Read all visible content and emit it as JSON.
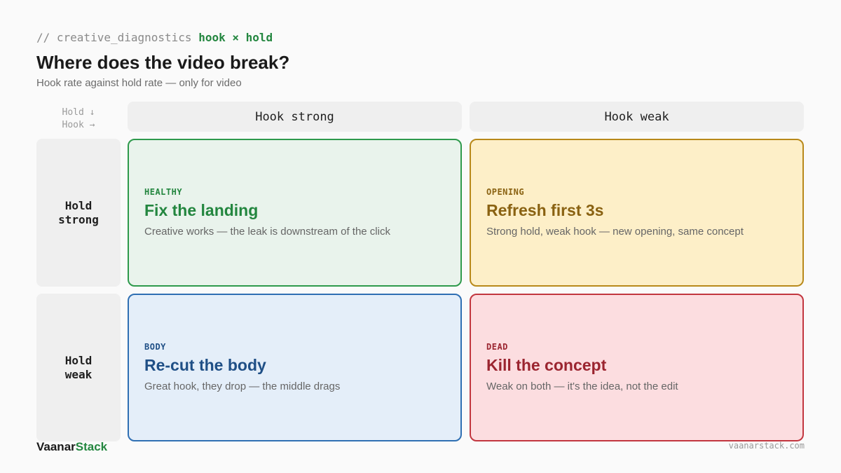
{
  "header": {
    "eyebrow_prefix": "// creative_diagnostics",
    "eyebrow_highlight": "hook × hold",
    "title": "Where does the video break?",
    "subtitle": "Hook rate against hold rate — only for video"
  },
  "axis_legend": {
    "rows_label": "Hold ↓",
    "cols_label": "Hook →"
  },
  "columns": [
    {
      "label": "Hook strong"
    },
    {
      "label": "Hook weak"
    }
  ],
  "rows": [
    {
      "line1": "Hold",
      "line2": "strong"
    },
    {
      "line1": "Hold",
      "line2": "weak"
    }
  ],
  "quadrants": [
    {
      "tag": "HEALTHY",
      "heading": "Fix the landing",
      "description": "Creative works — the leak is downstream of the click",
      "accent": "#23863f",
      "background": "#e9f3ec",
      "border": "#2e9a4c"
    },
    {
      "tag": "OPENING",
      "heading": "Refresh first 3s",
      "description": "Strong hold, weak hook — new opening, same concept",
      "accent": "#8a6212",
      "background": "#fdefc8",
      "border": "#b8891a"
    },
    {
      "tag": "BODY",
      "heading": "Re-cut the body",
      "description": "Great hook, they drop — the middle drags",
      "accent": "#1f4f86",
      "background": "#e4eef9",
      "border": "#2f6fb3"
    },
    {
      "tag": "DEAD",
      "heading": "Kill the concept",
      "description": "Weak on both — it's the idea, not the edit",
      "accent": "#9b2530",
      "background": "#fcdde0",
      "border": "#c2363f"
    }
  ],
  "footer": {
    "brand_main": "Vaanar",
    "brand_accent": "Stack",
    "site": "vaanarstack.com"
  }
}
